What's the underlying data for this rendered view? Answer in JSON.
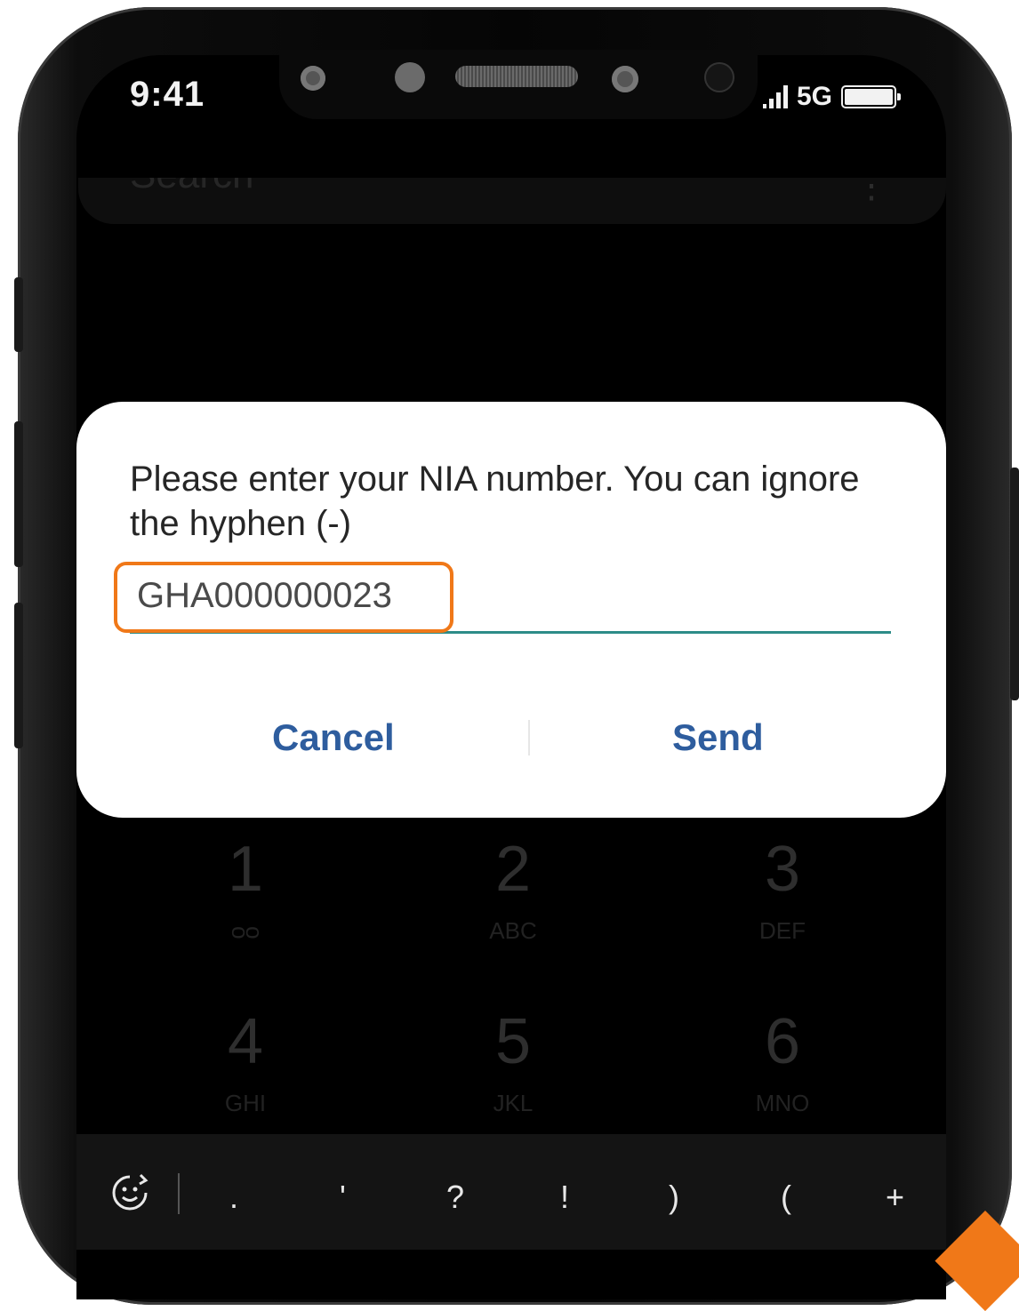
{
  "status_bar": {
    "time": "9:41",
    "network": "5G"
  },
  "search": {
    "placeholder": "Search",
    "menu_label": "⋮"
  },
  "dialog": {
    "prompt": "Please enter your NIA number. You can ignore the hyphen (-)",
    "input_value": "GHA000000023",
    "cancel_label": "Cancel",
    "send_label": "Send",
    "accent_color": "#2d8c88",
    "button_color": "#2e5d9e",
    "highlight_color": "#f07818"
  },
  "keypad": {
    "keys": [
      {
        "num": "1",
        "letters": "ᴑᴑ"
      },
      {
        "num": "2",
        "letters": "ABC"
      },
      {
        "num": "3",
        "letters": "DEF"
      },
      {
        "num": "4",
        "letters": "GHI"
      },
      {
        "num": "5",
        "letters": "JKL"
      },
      {
        "num": "6",
        "letters": "MNO"
      }
    ]
  },
  "toolbar": {
    "items": [
      ".",
      "'",
      "?",
      "!",
      ")",
      "(",
      "+"
    ]
  }
}
